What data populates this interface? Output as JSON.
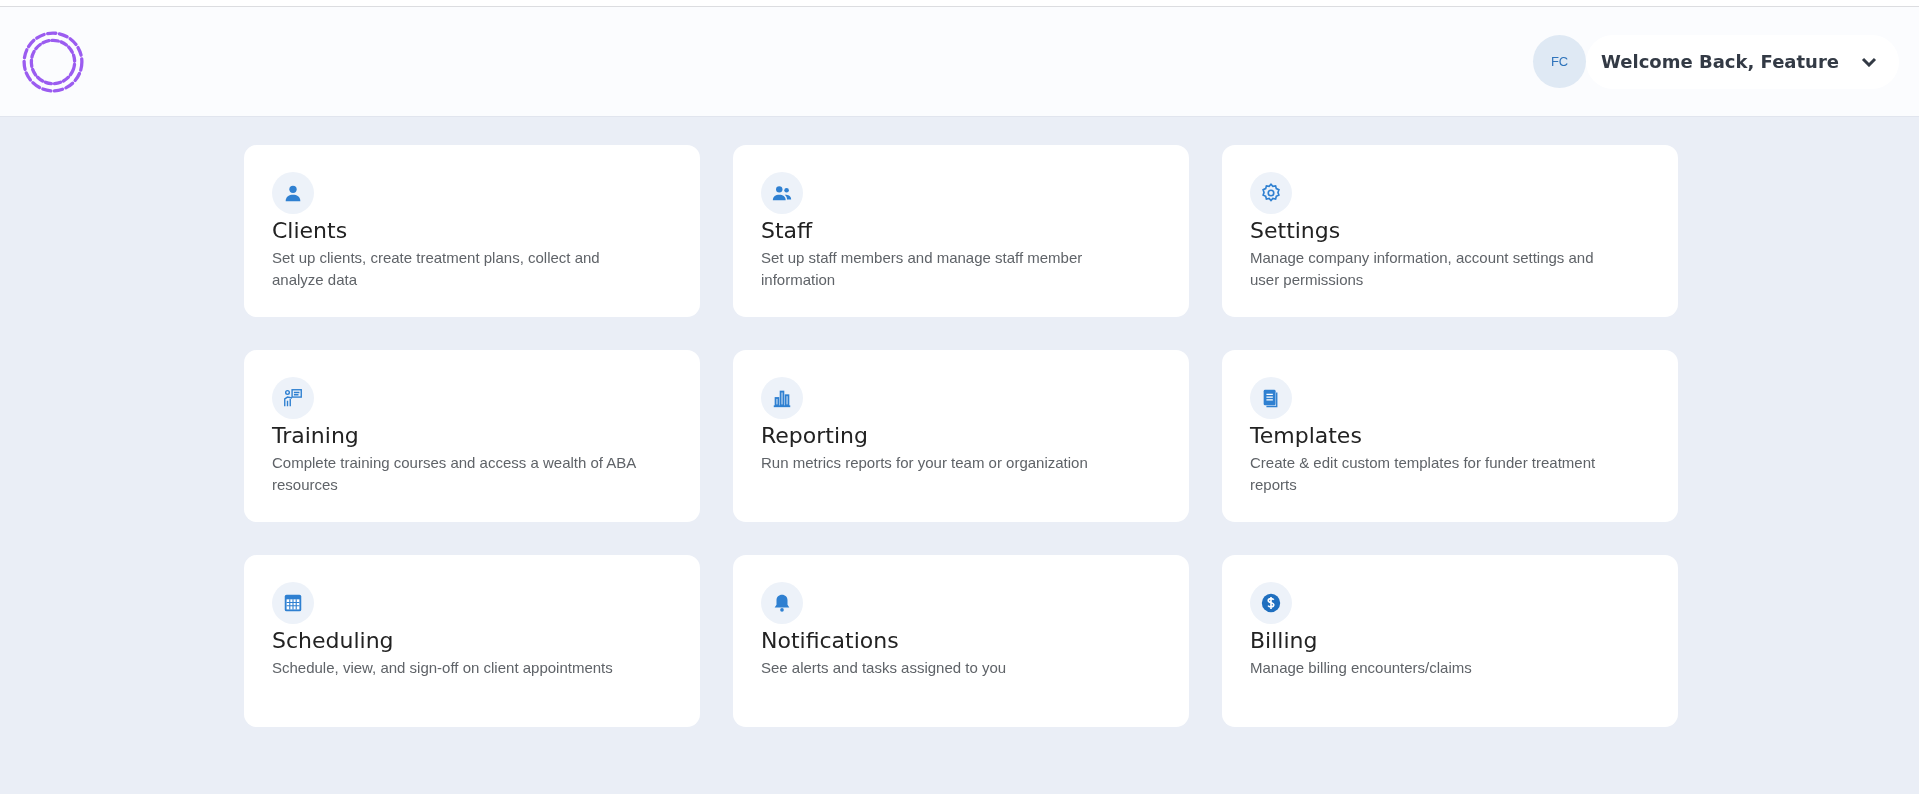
{
  "header": {
    "avatar_initials": "FC",
    "welcome": "Welcome Back, Feature"
  },
  "cards": [
    {
      "kind": "person",
      "title": "Clients",
      "description": "Set up clients, create treatment plans, collect and analyze data"
    },
    {
      "kind": "people",
      "title": "Staff",
      "description": "Set up staff members and manage staff member information"
    },
    {
      "kind": "gear",
      "title": "Settings",
      "description": "Manage company information, account settings and user permissions"
    },
    {
      "kind": "presentation",
      "title": "Training",
      "description": "Complete training courses and access a wealth of ABA resources"
    },
    {
      "kind": "chart",
      "title": "Reporting",
      "description": "Run metrics reports for your team or organization"
    },
    {
      "kind": "document",
      "title": "Templates",
      "description": "Create & edit custom templates for funder treatment reports"
    },
    {
      "kind": "calendar",
      "title": "Scheduling",
      "description": "Schedule, view, and sign-off on client appointments"
    },
    {
      "kind": "bell",
      "title": "Notifications",
      "description": "See alerts and tasks assigned to you"
    },
    {
      "kind": "dollar",
      "title": "Billing",
      "description": "Manage billing encounters/claims"
    }
  ]
}
